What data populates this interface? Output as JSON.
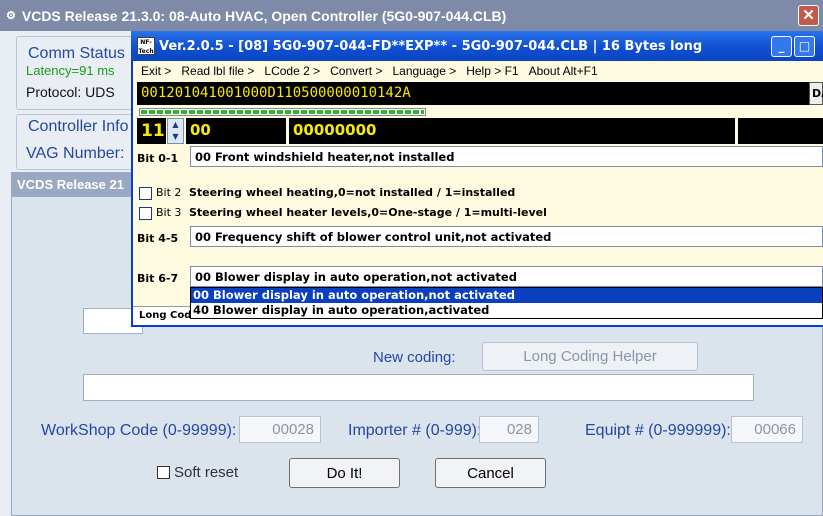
{
  "outer_window": {
    "title": "VCDS Release 21.3.0: 08-Auto HVAC,  Open Controller (5G0-907-044.CLB)",
    "close_symbol": "✕"
  },
  "comm_status": {
    "heading": "Comm Status",
    "latency": "Latency=91  ms",
    "protocol": "Protocol: UDS"
  },
  "controller_info": {
    "heading": "Controller Info",
    "vag_number_label": "VAG Number:"
  },
  "long_coding_window": {
    "title": "VCDS Release 21",
    "new_coding_label": "New coding:",
    "long_coding_helper_button": "Long Coding Helper",
    "workshop_label": "WorkShop Code (0-99999):",
    "workshop_value": "00028",
    "importer_label": "Importer # (0-999):",
    "importer_value": "028",
    "equip_label": "Equipt # (0-999999):",
    "equip_value": "00066",
    "soft_reset_label": "Soft reset",
    "do_it_button": "Do It!",
    "cancel_button": "Cancel"
  },
  "helper_window": {
    "logo_text": "NF-Tech",
    "title": "Ver.2.0.5 - [08] 5G0-907-044-FD**EXP** - 5G0-907-044.CLB | 16 Bytes long",
    "minimize_symbol": "_",
    "maximize_symbol": "□",
    "close_symbol": "✕",
    "menu": [
      {
        "label": "Exit >"
      },
      {
        "label": "Read lbl file >"
      },
      {
        "label": "LCode 2 >"
      },
      {
        "label": "Convert >"
      },
      {
        "label": "Language >"
      },
      {
        "label": "Help > F1"
      },
      {
        "label": "About  Alt+F1"
      }
    ],
    "coding_hex": "001201041001000D110500000010142A",
    "da_button": "DA",
    "byte_number": "11",
    "byte_hex": "00",
    "byte_binary": "00000000",
    "bits": {
      "bit01_label": "Bit 0-1",
      "bit01_value": "00 Front windshield heater,not installed",
      "bit2_label": "Bit 2",
      "bit2_text": "Steering wheel heating,0=not installed / 1=installed",
      "bit3_label": "Bit 3",
      "bit3_text": "Steering wheel heater levels,0=One-stage / 1=multi-level",
      "bit45_label": "Bit 4-5",
      "bit45_value": "00 Frequency shift of blower control unit,not activated",
      "bit67_label": "Bit 6-7",
      "bit67_value": "00 Blower display in auto operation,not activated"
    },
    "dropdown_options": [
      "00 Blower display in auto operation,not activated",
      "40 Blower display in auto operation,activated"
    ],
    "status_strip": "Long Cod"
  }
}
